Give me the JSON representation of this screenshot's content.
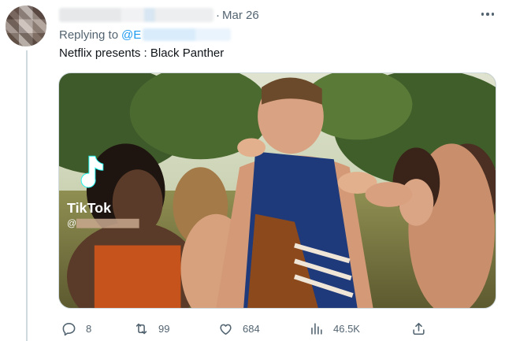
{
  "tweet": {
    "time": "Mar 26",
    "replying_prefix": "Replying to",
    "mention": "@E",
    "text": "Netflix presents : Black Panther",
    "watermark": "TikTok",
    "watermark_handle": "@"
  },
  "actions": {
    "replies": "8",
    "retweets": "99",
    "likes": "684",
    "views": "46.5K"
  },
  "icons": [
    "more-icon",
    "reply-icon",
    "retweet-icon",
    "like-icon",
    "views-icon",
    "share-icon",
    "tiktok-logo-icon"
  ],
  "colors": {
    "muted": "#536471",
    "link": "#1d9bf0",
    "text": "#0f1419",
    "line": "#cfd9de"
  }
}
